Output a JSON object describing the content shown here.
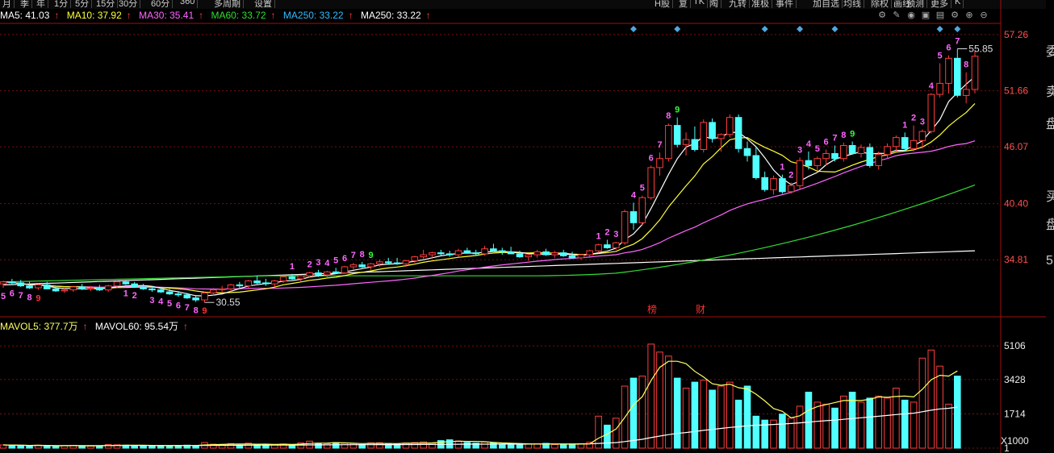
{
  "toolbar": {
    "tabs": [
      "月",
      "季",
      "年",
      "1分",
      "5分",
      "15分",
      "30分",
      "60分",
      "360",
      "多周期",
      "设置"
    ],
    "right_tabs": [
      "H股",
      "复",
      "TK",
      "陶",
      "九转",
      "准极",
      "事件",
      "加自选",
      "均线",
      "除权",
      "画线",
      "预测",
      "更多",
      "K"
    ]
  },
  "legend": {
    "ma5": "MA5: 41.03",
    "ma10": "MA10: 37.92",
    "ma30": "MA30: 35.41",
    "ma60": "MA60: 33.72",
    "ma250": "MA250: 33.22",
    "ma250b": "MA250: 33.22",
    "arrow": "↑"
  },
  "vol_legend": {
    "mavol5": "MAVOL5: 377.7万",
    "mavol60": "MAVOL60: 95.54万",
    "arrow": "↑"
  },
  "colors": {
    "up": "#ff3c3c",
    "down": "#50ffff",
    "ma5": "#ffffff",
    "ma10": "#ffff33",
    "ma30": "#ff66ff",
    "ma60": "#33dd33",
    "ma250": "#ffffff",
    "grid": "#7a1010",
    "axis_text": "#ff5050",
    "countdown_up": "#ff66ff",
    "countdown_9": "#33ff33",
    "marker": "#4fa8e0"
  },
  "icons": [
    "settings-icon",
    "pen-icon",
    "eye-icon",
    "lock-icon",
    "box-icon",
    "gear-icon",
    "zoom-in-icon",
    "zoom-out-icon"
  ],
  "right_panel": [
    "委",
    "卖",
    "盘",
    "买",
    "盘",
    "5"
  ],
  "chart_data": {
    "type": "candlestick",
    "price_axis": {
      "ticks": [
        "57.26",
        "51.66",
        "46.07",
        "40.40",
        "34.81"
      ],
      "ylim": [
        29.2,
        58.3
      ]
    },
    "volume_axis": {
      "ticks": [
        "5106",
        "3428",
        "1714",
        "1"
      ],
      "ylim": [
        0,
        5800
      ],
      "unit": "X1000"
    },
    "high_label": "55.85",
    "low_label": "30.55",
    "events": [
      "榜",
      "财"
    ],
    "candles": [
      [
        32.4,
        32.7,
        32.0,
        32.6
      ],
      [
        32.6,
        32.9,
        32.3,
        32.5
      ],
      [
        32.5,
        32.8,
        32.1,
        32.2
      ],
      [
        32.2,
        32.6,
        31.9,
        32.0
      ],
      [
        32.0,
        32.4,
        31.8,
        32.3
      ],
      [
        32.3,
        32.6,
        31.9,
        31.9
      ],
      [
        31.9,
        32.2,
        31.6,
        31.7
      ],
      [
        31.7,
        32.0,
        31.5,
        31.8
      ],
      [
        31.8,
        32.2,
        31.6,
        32.1
      ],
      [
        32.1,
        32.4,
        31.8,
        31.9
      ],
      [
        31.9,
        32.2,
        31.7,
        32.0
      ],
      [
        32.0,
        32.3,
        31.7,
        31.8
      ],
      [
        31.8,
        32.3,
        31.6,
        32.2
      ],
      [
        32.2,
        32.7,
        32.0,
        32.6
      ],
      [
        32.6,
        32.8,
        32.3,
        32.4
      ],
      [
        32.4,
        32.6,
        32.1,
        32.1
      ],
      [
        32.1,
        32.4,
        31.8,
        31.9
      ],
      [
        31.9,
        32.2,
        31.6,
        31.8
      ],
      [
        31.8,
        32.1,
        31.5,
        31.6
      ],
      [
        31.6,
        31.9,
        31.3,
        31.4
      ],
      [
        31.4,
        31.7,
        31.1,
        31.3
      ],
      [
        31.3,
        31.5,
        30.9,
        31.0
      ],
      [
        31.0,
        31.3,
        30.6,
        30.8
      ],
      [
        30.8,
        31.6,
        30.55,
        31.5
      ],
      [
        31.5,
        32.0,
        31.2,
        31.8
      ],
      [
        31.8,
        32.2,
        31.5,
        31.9
      ],
      [
        31.9,
        32.4,
        31.6,
        32.3
      ],
      [
        32.3,
        32.6,
        32.0,
        32.2
      ],
      [
        32.2,
        32.8,
        32.0,
        32.7
      ],
      [
        32.7,
        33.2,
        32.4,
        32.5
      ],
      [
        32.5,
        32.9,
        32.2,
        32.4
      ],
      [
        32.4,
        32.8,
        32.1,
        32.7
      ],
      [
        32.7,
        33.2,
        32.5,
        33.1
      ],
      [
        33.1,
        33.4,
        32.8,
        32.9
      ],
      [
        32.9,
        33.3,
        32.6,
        33.2
      ],
      [
        33.2,
        33.6,
        33.0,
        33.5
      ],
      [
        33.5,
        33.8,
        33.1,
        33.3
      ],
      [
        33.3,
        33.7,
        33.0,
        33.6
      ],
      [
        33.6,
        34.0,
        33.4,
        33.5
      ],
      [
        33.5,
        34.2,
        33.4,
        34.1
      ],
      [
        34.1,
        34.5,
        33.8,
        34.3
      ],
      [
        34.3,
        34.6,
        34.0,
        34.1
      ],
      [
        34.1,
        34.5,
        33.8,
        34.4
      ],
      [
        34.4,
        34.8,
        34.1,
        34.6
      ],
      [
        34.6,
        35.0,
        34.3,
        34.5
      ],
      [
        34.5,
        35.0,
        34.3,
        34.4
      ],
      [
        34.4,
        34.8,
        34.1,
        34.7
      ],
      [
        34.7,
        35.2,
        34.5,
        35.1
      ],
      [
        35.1,
        35.8,
        34.9,
        35.3
      ],
      [
        35.3,
        35.6,
        35.0,
        35.5
      ],
      [
        35.5,
        35.8,
        35.2,
        35.4
      ],
      [
        35.4,
        35.7,
        35.1,
        35.3
      ],
      [
        35.3,
        35.9,
        35.1,
        35.7
      ],
      [
        35.7,
        36.0,
        35.4,
        35.5
      ],
      [
        35.5,
        35.8,
        35.2,
        35.4
      ],
      [
        35.4,
        36.2,
        35.2,
        35.9
      ],
      [
        35.9,
        36.4,
        35.6,
        35.7
      ],
      [
        35.7,
        36.0,
        35.3,
        35.6
      ],
      [
        35.6,
        36.1,
        35.4,
        35.4
      ],
      [
        35.4,
        35.7,
        35.0,
        35.1
      ],
      [
        35.1,
        35.4,
        34.7,
        35.3
      ],
      [
        35.3,
        35.8,
        35.0,
        35.6
      ],
      [
        35.6,
        35.9,
        35.2,
        35.3
      ],
      [
        35.3,
        35.7,
        35.0,
        35.5
      ],
      [
        35.5,
        35.8,
        35.1,
        35.2
      ],
      [
        35.2,
        35.6,
        34.9,
        35.0
      ],
      [
        35.0,
        35.4,
        34.8,
        35.3
      ],
      [
        35.3,
        35.8,
        35.1,
        35.7
      ],
      [
        35.7,
        36.4,
        35.5,
        36.3
      ],
      [
        36.3,
        36.8,
        35.9,
        36.0
      ],
      [
        36.0,
        36.6,
        35.8,
        36.5
      ],
      [
        36.5,
        39.8,
        36.3,
        39.6
      ],
      [
        39.6,
        40.5,
        37.8,
        38.5
      ],
      [
        38.5,
        41.2,
        38.2,
        41.0
      ],
      [
        41.0,
        44.2,
        40.8,
        44.0
      ],
      [
        44.0,
        45.5,
        43.2,
        44.9
      ],
      [
        44.9,
        48.4,
        44.6,
        48.2
      ],
      [
        48.2,
        49.0,
        46.0,
        46.3
      ],
      [
        46.3,
        47.5,
        45.2,
        46.8
      ],
      [
        46.8,
        48.1,
        45.6,
        45.8
      ],
      [
        45.8,
        48.8,
        45.5,
        48.5
      ],
      [
        48.5,
        48.9,
        46.5,
        46.9
      ],
      [
        46.9,
        47.4,
        45.6,
        47.3
      ],
      [
        47.3,
        49.3,
        47.0,
        49.0
      ],
      [
        49.0,
        49.3,
        45.5,
        45.9
      ],
      [
        45.9,
        46.6,
        44.6,
        45.2
      ],
      [
        45.2,
        46.1,
        42.8,
        43.0
      ],
      [
        43.0,
        43.6,
        41.6,
        41.8
      ],
      [
        41.8,
        43.2,
        41.3,
        42.9
      ],
      [
        42.9,
        43.3,
        41.4,
        41.6
      ],
      [
        41.6,
        42.5,
        41.4,
        42.2
      ],
      [
        42.2,
        45.0,
        41.9,
        44.7
      ],
      [
        44.7,
        45.6,
        43.8,
        44.2
      ],
      [
        44.2,
        45.1,
        43.6,
        44.9
      ],
      [
        44.9,
        45.8,
        44.2,
        45.4
      ],
      [
        45.4,
        46.2,
        44.6,
        44.9
      ],
      [
        44.9,
        46.5,
        44.6,
        46.2
      ],
      [
        46.2,
        46.6,
        45.3,
        45.4
      ],
      [
        45.4,
        46.3,
        45.0,
        46.0
      ],
      [
        46.0,
        46.4,
        44.0,
        44.2
      ],
      [
        44.2,
        45.6,
        43.8,
        45.3
      ],
      [
        45.3,
        46.4,
        44.9,
        46.1
      ],
      [
        46.1,
        47.2,
        45.6,
        47.0
      ],
      [
        47.0,
        47.5,
        45.6,
        45.9
      ],
      [
        45.9,
        48.2,
        45.6,
        46.7
      ],
      [
        46.7,
        47.8,
        45.9,
        47.6
      ],
      [
        47.6,
        51.4,
        47.4,
        51.3
      ],
      [
        51.3,
        54.4,
        51.0,
        52.4
      ],
      [
        52.4,
        55.2,
        51.4,
        54.9
      ],
      [
        54.9,
        55.85,
        51.0,
        51.2
      ],
      [
        51.2,
        53.5,
        50.4,
        51.8
      ],
      [
        51.8,
        55.7,
        51.4,
        55.1
      ]
    ],
    "volumes": [
      160,
      145,
      130,
      110,
      150,
      120,
      100,
      130,
      140,
      115,
      100,
      120,
      180,
      170,
      150,
      130,
      120,
      110,
      140,
      125,
      135,
      150,
      110,
      280,
      200,
      190,
      230,
      150,
      250,
      170,
      200,
      160,
      210,
      180,
      260,
      350,
      250,
      220,
      280,
      240,
      230,
      180,
      260,
      270,
      230,
      200,
      260,
      280,
      320,
      250,
      380,
      420,
      360,
      280,
      250,
      310,
      260,
      200,
      210,
      180,
      220,
      210,
      240,
      180,
      170,
      210,
      220,
      300,
      1600,
      1150,
      1500,
      3100,
      3500,
      3600,
      5200,
      4800,
      4600,
      3500,
      3000,
      3300,
      3400,
      2900,
      3100,
      3300,
      2400,
      3100,
      1600,
      1400,
      1400,
      1700,
      1500,
      2100,
      2800,
      2300,
      2200,
      2000,
      2600,
      2800,
      2300,
      2500,
      2600,
      2500,
      3000,
      2400,
      2300,
      4500,
      4900,
      4100,
      2200,
      3600
    ],
    "countdown_labels": [
      {
        "i": 0,
        "t": "5",
        "pos": "below"
      },
      {
        "i": 1,
        "t": "6",
        "pos": "below"
      },
      {
        "i": 2,
        "t": "7",
        "pos": "below"
      },
      {
        "i": 3,
        "t": "8",
        "pos": "below"
      },
      {
        "i": 4,
        "t": "9",
        "pos": "below",
        "red": true
      },
      {
        "i": 14,
        "t": "1",
        "pos": "below"
      },
      {
        "i": 15,
        "t": "2",
        "pos": "below"
      },
      {
        "i": 17,
        "t": "3",
        "pos": "below"
      },
      {
        "i": 18,
        "t": "4",
        "pos": "below"
      },
      {
        "i": 19,
        "t": "5",
        "pos": "below"
      },
      {
        "i": 20,
        "t": "6",
        "pos": "below"
      },
      {
        "i": 21,
        "t": "7",
        "pos": "below"
      },
      {
        "i": 22,
        "t": "8",
        "pos": "below"
      },
      {
        "i": 23,
        "t": "9",
        "pos": "below",
        "red": true
      },
      {
        "i": 33,
        "t": "1",
        "pos": "above"
      },
      {
        "i": 35,
        "t": "2",
        "pos": "above"
      },
      {
        "i": 36,
        "t": "3",
        "pos": "above"
      },
      {
        "i": 37,
        "t": "4",
        "pos": "above"
      },
      {
        "i": 38,
        "t": "5",
        "pos": "above"
      },
      {
        "i": 39,
        "t": "6",
        "pos": "above"
      },
      {
        "i": 40,
        "t": "7",
        "pos": "above"
      },
      {
        "i": 41,
        "t": "8",
        "pos": "above"
      },
      {
        "i": 42,
        "t": "9",
        "pos": "above",
        "green": true
      },
      {
        "i": 68,
        "t": "1",
        "pos": "above"
      },
      {
        "i": 69,
        "t": "2",
        "pos": "above"
      },
      {
        "i": 70,
        "t": "3",
        "pos": "above"
      },
      {
        "i": 72,
        "t": "4",
        "pos": "above"
      },
      {
        "i": 73,
        "t": "5",
        "pos": "above"
      },
      {
        "i": 74,
        "t": "6",
        "pos": "above"
      },
      {
        "i": 75,
        "t": "7",
        "pos": "above"
      },
      {
        "i": 76,
        "t": "8",
        "pos": "above"
      },
      {
        "i": 77,
        "t": "9",
        "pos": "above",
        "green": true
      },
      {
        "i": 89,
        "t": "1",
        "pos": "above"
      },
      {
        "i": 90,
        "t": "2",
        "pos": "above"
      },
      {
        "i": 91,
        "t": "3",
        "pos": "above"
      },
      {
        "i": 92,
        "t": "4",
        "pos": "above"
      },
      {
        "i": 93,
        "t": "5",
        "pos": "above"
      },
      {
        "i": 94,
        "t": "6",
        "pos": "above"
      },
      {
        "i": 95,
        "t": "7",
        "pos": "above"
      },
      {
        "i": 96,
        "t": "8",
        "pos": "above"
      },
      {
        "i": 97,
        "t": "9",
        "pos": "above",
        "green": true
      },
      {
        "i": 103,
        "t": "1",
        "pos": "above"
      },
      {
        "i": 104,
        "t": "2",
        "pos": "above"
      },
      {
        "i": 105,
        "t": "3",
        "pos": "above"
      },
      {
        "i": 106,
        "t": "4",
        "pos": "above"
      },
      {
        "i": 107,
        "t": "5",
        "pos": "above"
      },
      {
        "i": 108,
        "t": "6",
        "pos": "above"
      },
      {
        "i": 109,
        "t": "7",
        "pos": "above"
      },
      {
        "i": 110,
        "t": "8",
        "pos": "above"
      }
    ],
    "markers": [
      72,
      77,
      87,
      91,
      95,
      107,
      109
    ]
  }
}
